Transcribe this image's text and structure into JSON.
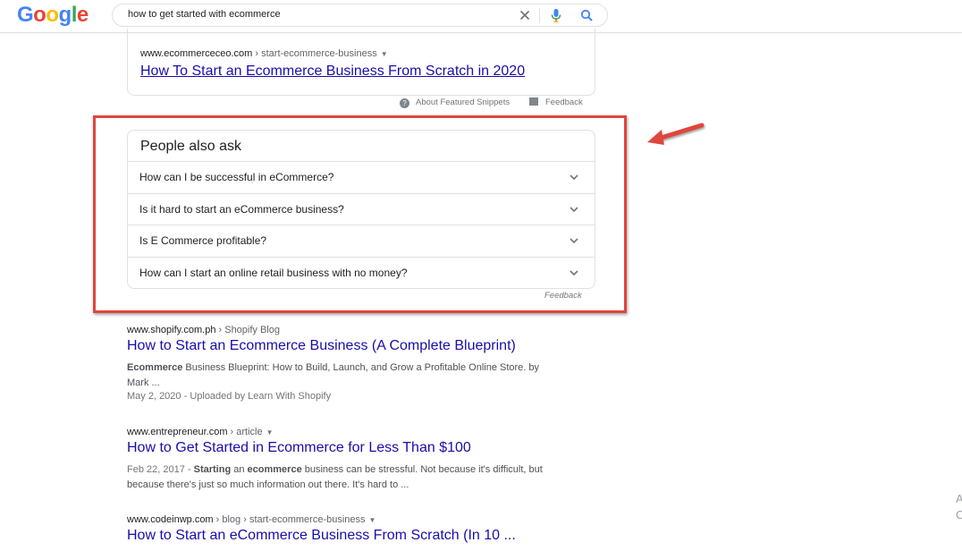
{
  "header": {
    "logo_letters": [
      {
        "ch": "G",
        "color": "#4285f4"
      },
      {
        "ch": "o",
        "color": "#ea4335"
      },
      {
        "ch": "o",
        "color": "#fbbc05"
      },
      {
        "ch": "g",
        "color": "#4285f4"
      },
      {
        "ch": "l",
        "color": "#34a853"
      },
      {
        "ch": "e",
        "color": "#ea4335"
      }
    ],
    "search_query": "how to get started with ecommerce"
  },
  "snippet": {
    "site": "www.ecommerceceo.com",
    "path": " › start-ecommerce-business",
    "title": "How To Start an Ecommerce Business From Scratch in 2020",
    "about_label": "About Featured Snippets",
    "feedback_label": "Feedback"
  },
  "paa": {
    "title": "People also ask",
    "questions": [
      "How can I be successful in eCommerce?",
      "Is it hard to start an eCommerce business?",
      "Is E Commerce profitable?",
      "How can I start an online retail business with no money?"
    ],
    "feedback_label": "Feedback"
  },
  "results": [
    {
      "site": "www.shopify.com.ph",
      "path": " › Shopify Blog",
      "title": "How to Start an Ecommerce Business (A Complete Blueprint)",
      "desc_bold": "Ecommerce",
      "desc_rest": " Business Blueprint: How to Build, Launch, and Grow a Profitable Online Store. by Mark ...",
      "meta": "May 2, 2020 - Uploaded by Learn With Shopify"
    },
    {
      "site": "www.entrepreneur.com",
      "path": " › article",
      "title": "How to Get Started in Ecommerce for Less Than $100",
      "date": "Feb 22, 2017 - ",
      "desc_b1": "Starting",
      "desc_mid1": " an ",
      "desc_b2": "ecommerce",
      "desc_rest": " business can be stressful. Not because it's difficult, but because there's just so much information out there. It's hard to ..."
    },
    {
      "site": "www.codeinwp.com",
      "path": " › blog › start-ecommerce-business",
      "title": "How to Start an eCommerce Business From Scratch (In 10 ..."
    }
  ],
  "edge_glyphs": [
    "A",
    "C"
  ],
  "colors": {
    "link": "#1a0dab",
    "highlight": "#e0463c"
  }
}
